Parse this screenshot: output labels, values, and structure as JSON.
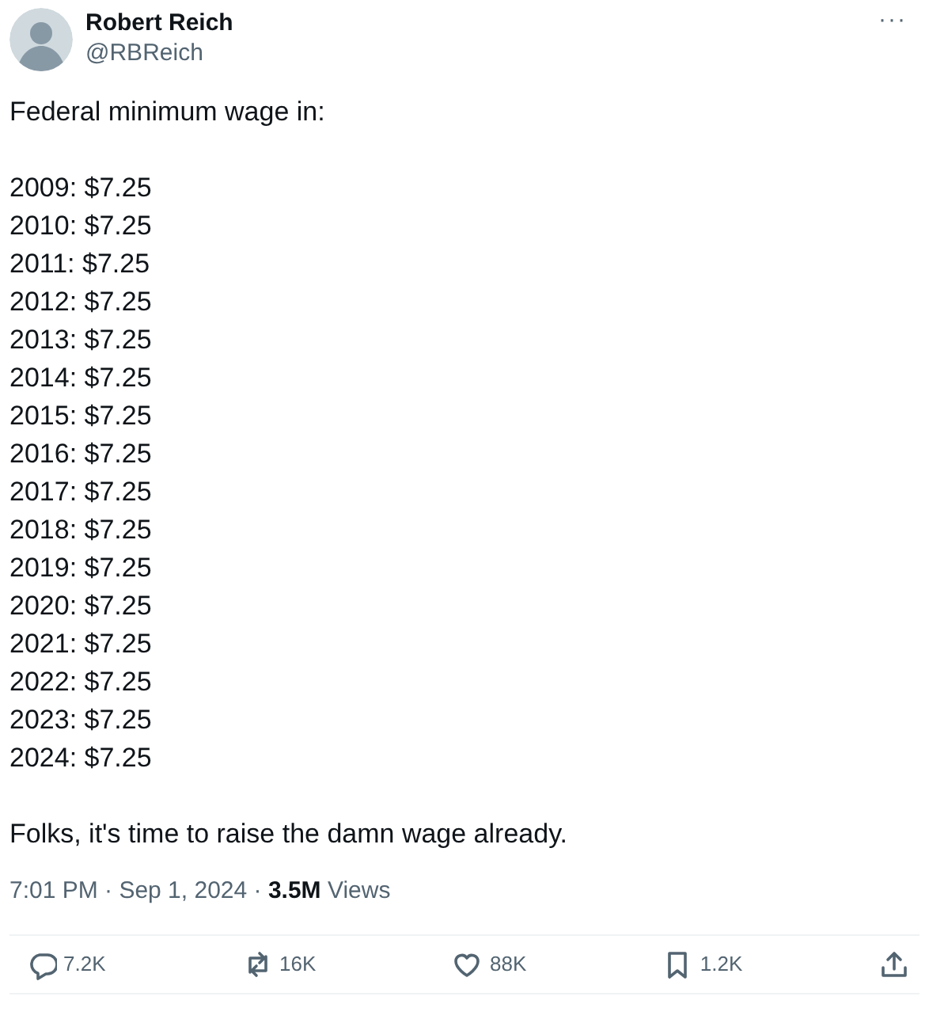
{
  "author": {
    "name": "Robert Reich",
    "handle": "@RBReich",
    "menu": "···"
  },
  "text": {
    "intro": "Federal minimum wage in:",
    "lines": [
      "2009: $7.25",
      "2010: $7.25",
      "2011: $7.25",
      "2012: $7.25",
      "2013: $7.25",
      "2014: $7.25",
      "2015: $7.25",
      "2016: $7.25",
      "2017: $7.25",
      "2018: $7.25",
      "2019: $7.25",
      "2020: $7.25",
      "2021: $7.25",
      "2022: $7.25",
      "2023: $7.25",
      "2024: $7.25"
    ],
    "closing": "Folks, it's time to raise the damn wage already."
  },
  "meta": "7:01 PM · Sep 1, 2024 · **3.5M** Views",
  "actions": [
    {
      "kind": "reply",
      "count": "7.2K"
    },
    {
      "kind": "repost",
      "count": "16K"
    },
    {
      "kind": "like",
      "count": "88K"
    },
    {
      "kind": "bookmark",
      "count": "1.2K"
    },
    {
      "kind": "share"
    }
  ]
}
